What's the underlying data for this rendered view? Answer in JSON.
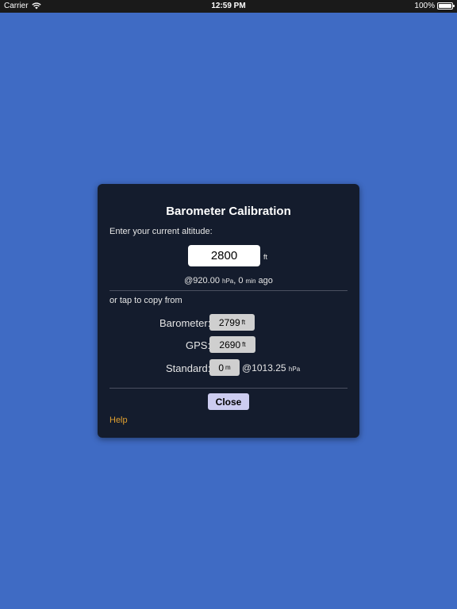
{
  "status_bar": {
    "carrier": "Carrier",
    "time": "12:59 PM",
    "battery": "100%"
  },
  "dialog": {
    "title": "Barometer Calibration",
    "prompt": "Enter your current altitude:",
    "altitude_value": "2800",
    "altitude_unit": "ft",
    "pressure": {
      "at": "@920.00",
      "pressure_unit": "hPa",
      "separator": ",",
      "minutes": "0",
      "minutes_unit": "min",
      "ago": "ago"
    },
    "copy_label": "or tap to copy from",
    "sources": {
      "barometer": {
        "label": "Barometer:",
        "value": "2799",
        "unit": "ft"
      },
      "gps": {
        "label": "GPS:",
        "value": "2690",
        "unit": "ft"
      },
      "standard": {
        "label": "Standard:",
        "value": "0",
        "unit": "m",
        "pressure": "@1013.25",
        "pressure_unit": "hPa"
      }
    },
    "close_label": "Close",
    "help_label": "Help"
  },
  "colors": {
    "background": "#3f6bc4",
    "dialog": "#141c2d",
    "help_link": "#e0a030",
    "close_button": "#ccccf0"
  }
}
